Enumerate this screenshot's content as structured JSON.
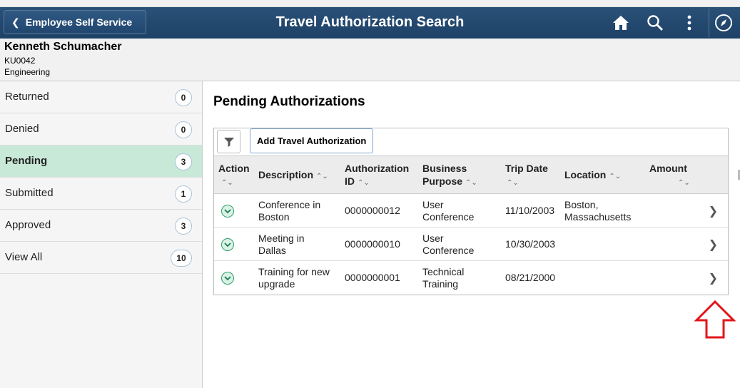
{
  "header": {
    "back_label": "Employee Self Service",
    "title": "Travel Authorization Search",
    "icons": [
      "home-icon",
      "search-icon",
      "more-vertical-icon",
      "navbar-compass-icon"
    ]
  },
  "user": {
    "name": "Kenneth Schumacher",
    "id": "KU0042",
    "department": "Engineering"
  },
  "sidebar": {
    "items": [
      {
        "label": "Returned",
        "count": "0"
      },
      {
        "label": "Denied",
        "count": "0"
      },
      {
        "label": "Pending",
        "count": "3"
      },
      {
        "label": "Submitted",
        "count": "1"
      },
      {
        "label": "Approved",
        "count": "3"
      },
      {
        "label": "View All",
        "count": "10"
      }
    ],
    "active": "Pending"
  },
  "main": {
    "title": "Pending Authorizations",
    "add_button": "Add Travel Authorization",
    "columns": {
      "action": "Action",
      "description": "Description",
      "auth_id_1": "Authorization",
      "auth_id_2": "ID",
      "purpose_1": "Business",
      "purpose_2": "Purpose",
      "trip_date": "Trip Date",
      "location": "Location",
      "amount": "Amount"
    },
    "rows": [
      {
        "desc1": "Conference in",
        "desc2": "Boston",
        "id": "0000000012",
        "purpose1": "User",
        "purpose2": "Conference",
        "date": "11/10/2003",
        "loc1": "Boston,",
        "loc2": "Massachusetts",
        "amount": ""
      },
      {
        "desc1": "Meeting in",
        "desc2": "Dallas",
        "id": "0000000010",
        "purpose1": "User",
        "purpose2": "Conference",
        "date": "10/30/2003",
        "loc1": "",
        "loc2": "",
        "amount": ""
      },
      {
        "desc1": "Training for new",
        "desc2": "upgrade",
        "id": "0000000001",
        "purpose1": "Technical",
        "purpose2": "Training",
        "date": "08/21/2000",
        "loc1": "",
        "loc2": "",
        "amount": ""
      }
    ]
  },
  "colors": {
    "header_bg": "#1e4167",
    "active_item_bg": "#c8e8d8",
    "action_icon": "#2f9d6a",
    "annotation_arrow": "#e0161b"
  }
}
